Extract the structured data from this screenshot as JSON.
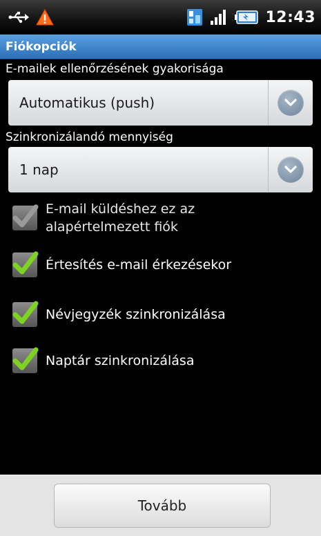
{
  "status_bar": {
    "time": "12:43",
    "icons": [
      "usb-icon",
      "warning-icon",
      "network-icon",
      "signal-icon",
      "battery-icon"
    ]
  },
  "title_bar": {
    "title": "Fiókopciók"
  },
  "check_frequency": {
    "label": "E-mailek ellenőrzésének gyakorisága",
    "value": "Automatikus (push)"
  },
  "sync_amount": {
    "label": "Szinkronizálandó mennyiség",
    "value": "1 nap"
  },
  "checkboxes": [
    {
      "label_line1": "E-mail küldéshez ez az",
      "label_line2": "alapértelmezett fiók",
      "checked": true,
      "enabled": false
    },
    {
      "label": "Értesítés e-mail érkezésekor",
      "checked": true,
      "enabled": true
    },
    {
      "label": "Névjegyzék szinkronizálása",
      "checked": true,
      "enabled": true
    },
    {
      "label": "Naptár szinkronizálása",
      "checked": true,
      "enabled": true
    }
  ],
  "bottom": {
    "next_label": "Tovább"
  },
  "colors": {
    "accent_title": "#3b82cc",
    "check_green": "#7ed321",
    "check_disabled": "#9a9a9a"
  }
}
